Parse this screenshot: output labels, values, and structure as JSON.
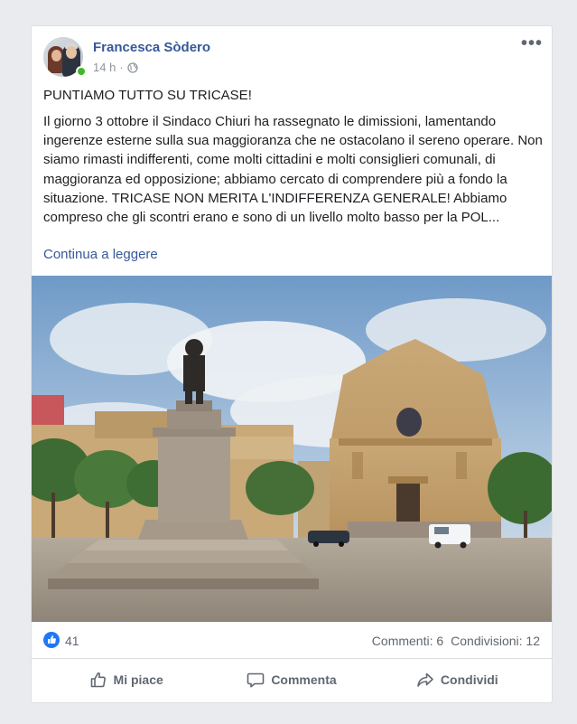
{
  "post": {
    "author": "Francesca Sòdero",
    "time": "14 h",
    "separator": "·",
    "privacy_icon": "globe-icon",
    "more_icon": "more-options-icon",
    "more_label": "•••",
    "title": "PUNTIAMO TUTTO SU TRICASE!",
    "body": "Il giorno 3 ottobre il Sindaco Chiuri ha rassegnato le dimissioni, lamentando ingerenze esterne sulla sua maggioranza che ne ostacolano il sereno operare. Non siamo rimasti indifferenti, come molti cittadini e molti consiglieri comunali, di maggioranza ed opposizione; abbiamo cercato di comprendere più a fondo la situazione. TRICASE NON MERITA L'INDIFFERENZA GENERALE! Abbiamo compreso che gli scontri erano e sono di un livello molto basso per la POL...",
    "continue_label": "Continua a leggere"
  },
  "stats": {
    "reaction_icon": "like-reaction-icon",
    "likes": "41",
    "comments": "Commenti: 6",
    "shares": "Condivisioni: 12"
  },
  "actions": {
    "like": "Mi piace",
    "comment": "Commenta",
    "share": "Condividi"
  },
  "colors": {
    "link": "#365899",
    "like_blue": "#2078f4",
    "online": "#42b72a",
    "background": "#e9ebee"
  }
}
